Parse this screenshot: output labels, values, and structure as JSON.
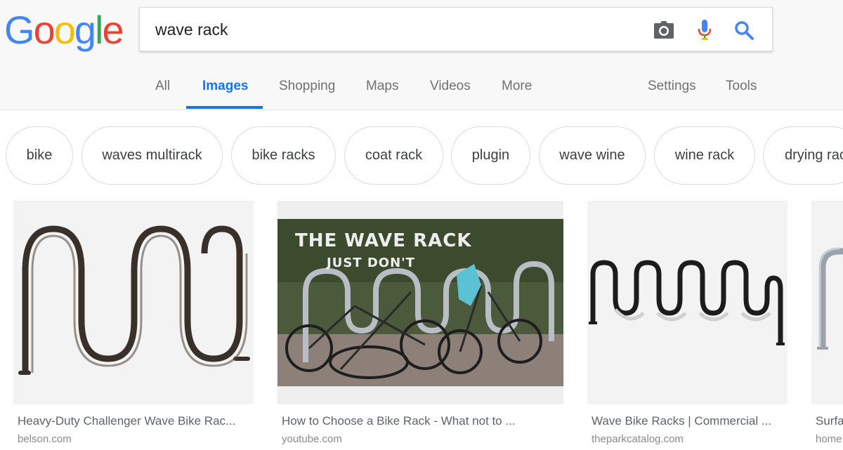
{
  "logo": {
    "letters": [
      "G",
      "o",
      "o",
      "g",
      "l",
      "e"
    ]
  },
  "search": {
    "query": "wave rack"
  },
  "search_icons": {
    "camera": "camera-icon",
    "mic": "microphone-icon",
    "search": "search-icon"
  },
  "tabs": [
    "All",
    "Images",
    "Shopping",
    "Maps",
    "Videos",
    "More",
    "Settings",
    "Tools"
  ],
  "active_tab": "Images",
  "colors": {
    "accent": "#1a73e8",
    "logo_blue": "#4285f4",
    "logo_red": "#ea4335",
    "logo_yellow": "#fbbc05",
    "logo_green": "#34a853"
  },
  "chips": [
    "bike",
    "waves multirack",
    "bike racks",
    "coat rack",
    "plugin",
    "wave wine",
    "wine rack",
    "drying rac"
  ],
  "results": [
    {
      "caption": "Heavy-Duty Challenger Wave Bike Rac...",
      "domain": "belson.com"
    },
    {
      "caption": "How to Choose a Bike Rack - What not to ...",
      "domain": "youtube.com",
      "overlay_title": "THE WAVE RACK",
      "overlay_subtitle": "JUST DON'T"
    },
    {
      "caption": "Wave Bike Racks | Commercial ...",
      "domain": "theparkcatalog.com"
    },
    {
      "caption": "Surfa",
      "domain": "home"
    }
  ]
}
